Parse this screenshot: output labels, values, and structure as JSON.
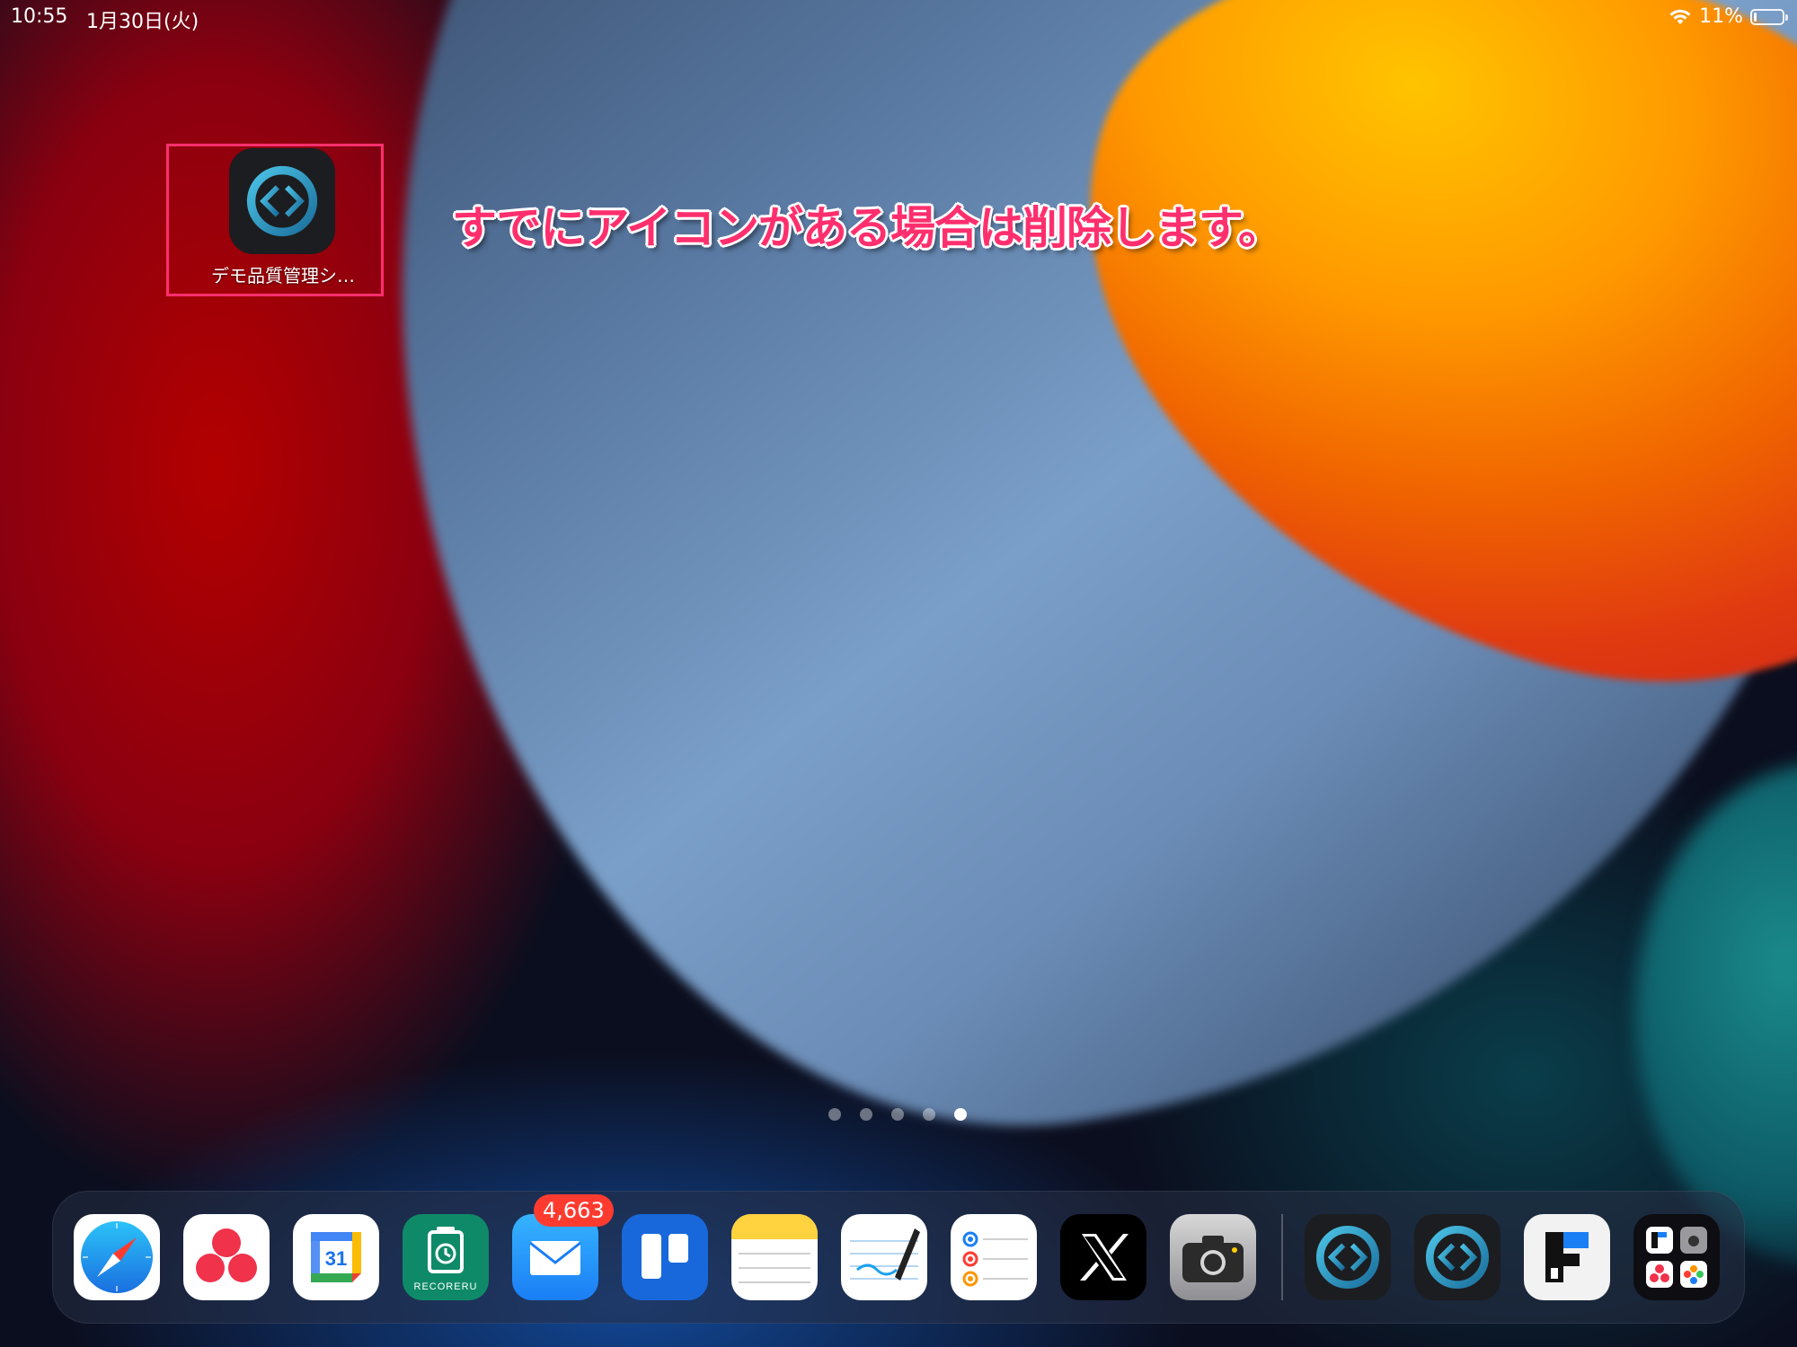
{
  "status_bar": {
    "time": "10:55",
    "date": "1月30日(火)",
    "battery": "11%",
    "battery_level": 0.11
  },
  "home_app": {
    "label": "デモ品質管理シ…",
    "icon": "claris-filemaker-icon"
  },
  "annotation": {
    "text": "すでにアイコンがある場合は削除します。",
    "color": "#ff2f6e"
  },
  "page_indicator": {
    "pages": 5,
    "current": 5
  },
  "dock": {
    "apps": [
      {
        "name": "safari",
        "icon": "safari-icon"
      },
      {
        "name": "asana",
        "icon": "asana-icon"
      },
      {
        "name": "google-calendar",
        "icon": "google-calendar-icon",
        "text": "31"
      },
      {
        "name": "recoreru",
        "icon": "recoreru-icon",
        "text": "RECORERU"
      },
      {
        "name": "mail",
        "icon": "mail-icon",
        "badge": "4,663"
      },
      {
        "name": "trello",
        "icon": "trello-icon"
      },
      {
        "name": "notes",
        "icon": "notes-icon"
      },
      {
        "name": "freeform",
        "icon": "freeform-icon"
      },
      {
        "name": "reminders",
        "icon": "reminders-icon"
      },
      {
        "name": "x",
        "icon": "x-icon"
      },
      {
        "name": "camera",
        "icon": "camera-icon"
      },
      {
        "name": "filemaker-go",
        "icon": "claris-filemaker-icon"
      },
      {
        "name": "filemaker-go-2",
        "icon": "claris-filemaker-icon"
      },
      {
        "name": "forms-app",
        "icon": "forms-app-icon"
      },
      {
        "name": "app-library",
        "icon": "app-library-icon"
      }
    ]
  }
}
